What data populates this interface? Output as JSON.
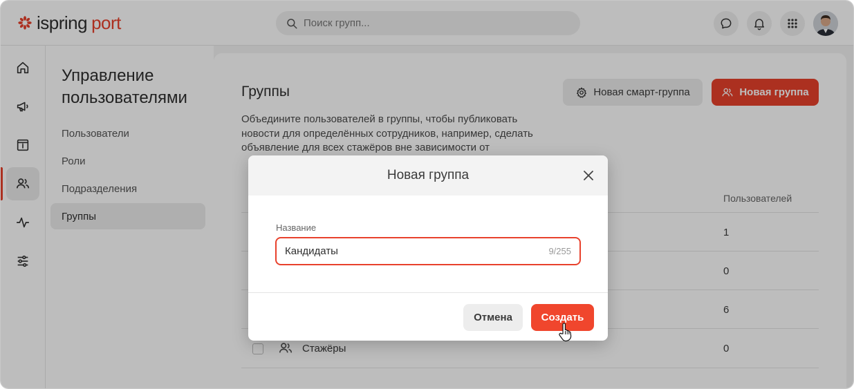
{
  "header": {
    "brand": "ispring",
    "brand_accent": "port",
    "search_placeholder": "Поиск групп..."
  },
  "sidebar": {
    "title": "Управление пользователями",
    "items": [
      {
        "label": "Пользователи",
        "active": false
      },
      {
        "label": "Роли",
        "active": false
      },
      {
        "label": "Подразделения",
        "active": false
      },
      {
        "label": "Группы",
        "active": true
      }
    ]
  },
  "main": {
    "title": "Группы",
    "description": "Объедините пользователей в группы, чтобы публиковать новости для определённых сотрудников, например, сделать объявление для всех стажёров вне зависимости от",
    "smart_group_button": "Новая смарт-группа",
    "new_group_button": "Новая группа",
    "table": {
      "users_column": "Пользователей",
      "rows": [
        {
          "name": "",
          "users": "1"
        },
        {
          "name": "",
          "users": "0"
        },
        {
          "name": "",
          "users": "6"
        },
        {
          "name": "Стажёры",
          "users": "0"
        }
      ]
    }
  },
  "modal": {
    "title": "Новая группа",
    "field_label": "Название",
    "field_value": "Кандидаты",
    "counter": "9/255",
    "cancel_label": "Отмена",
    "create_label": "Создать"
  },
  "colors": {
    "accent": "#e8412c",
    "overlay": "rgba(0,0,0,0.26)"
  }
}
